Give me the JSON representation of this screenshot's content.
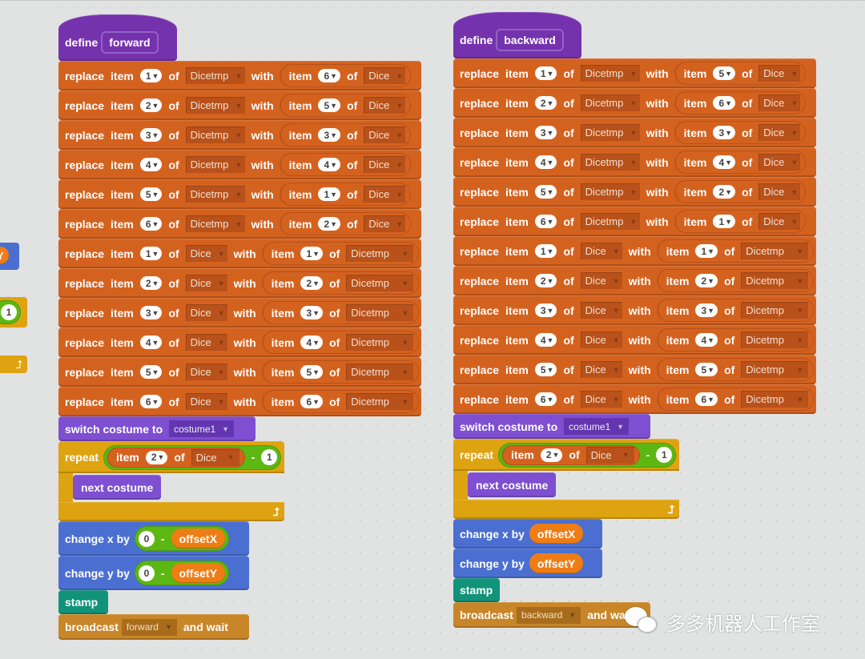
{
  "scripts": [
    {
      "hat": {
        "keyword": "define",
        "name": "forward"
      },
      "replace_blocks": [
        {
          "index": "1",
          "list": "Dicetmp",
          "src_index": "6",
          "src_list": "Dice"
        },
        {
          "index": "2",
          "list": "Dicetmp",
          "src_index": "5",
          "src_list": "Dice"
        },
        {
          "index": "3",
          "list": "Dicetmp",
          "src_index": "3",
          "src_list": "Dice"
        },
        {
          "index": "4",
          "list": "Dicetmp",
          "src_index": "4",
          "src_list": "Dice"
        },
        {
          "index": "5",
          "list": "Dicetmp",
          "src_index": "1",
          "src_list": "Dice"
        },
        {
          "index": "6",
          "list": "Dicetmp",
          "src_index": "2",
          "src_list": "Dice"
        },
        {
          "index": "1",
          "list": "Dice",
          "src_index": "1",
          "src_list": "Dicetmp"
        },
        {
          "index": "2",
          "list": "Dice",
          "src_index": "2",
          "src_list": "Dicetmp"
        },
        {
          "index": "3",
          "list": "Dice",
          "src_index": "3",
          "src_list": "Dicetmp"
        },
        {
          "index": "4",
          "list": "Dice",
          "src_index": "4",
          "src_list": "Dicetmp"
        },
        {
          "index": "5",
          "list": "Dice",
          "src_index": "5",
          "src_list": "Dicetmp"
        },
        {
          "index": "6",
          "list": "Dice",
          "src_index": "6",
          "src_list": "Dicetmp"
        }
      ],
      "switch_costume": {
        "label": "switch costume to",
        "value": "costume1"
      },
      "repeat": {
        "label": "repeat",
        "item_index": "2",
        "list": "Dice",
        "operator": "-",
        "operand": "1",
        "inner": "next costume"
      },
      "change_x": {
        "label": "change x by",
        "left": "0",
        "operator": "-",
        "var": "offsetX"
      },
      "change_y": {
        "label": "change y by",
        "left": "0",
        "operator": "-",
        "var": "offsetY"
      },
      "stamp": "stamp",
      "broadcast": {
        "label": "broadcast",
        "message": "forward",
        "suffix": "and wait"
      }
    },
    {
      "hat": {
        "keyword": "define",
        "name": "backward"
      },
      "replace_blocks": [
        {
          "index": "1",
          "list": "Dicetmp",
          "src_index": "5",
          "src_list": "Dice"
        },
        {
          "index": "2",
          "list": "Dicetmp",
          "src_index": "6",
          "src_list": "Dice"
        },
        {
          "index": "3",
          "list": "Dicetmp",
          "src_index": "3",
          "src_list": "Dice"
        },
        {
          "index": "4",
          "list": "Dicetmp",
          "src_index": "4",
          "src_list": "Dice"
        },
        {
          "index": "5",
          "list": "Dicetmp",
          "src_index": "2",
          "src_list": "Dice"
        },
        {
          "index": "6",
          "list": "Dicetmp",
          "src_index": "1",
          "src_list": "Dice"
        },
        {
          "index": "1",
          "list": "Dice",
          "src_index": "1",
          "src_list": "Dicetmp"
        },
        {
          "index": "2",
          "list": "Dice",
          "src_index": "2",
          "src_list": "Dicetmp"
        },
        {
          "index": "3",
          "list": "Dice",
          "src_index": "3",
          "src_list": "Dicetmp"
        },
        {
          "index": "4",
          "list": "Dice",
          "src_index": "4",
          "src_list": "Dicetmp"
        },
        {
          "index": "5",
          "list": "Dice",
          "src_index": "5",
          "src_list": "Dicetmp"
        },
        {
          "index": "6",
          "list": "Dice",
          "src_index": "6",
          "src_list": "Dicetmp"
        }
      ],
      "switch_costume": {
        "label": "switch costume to",
        "value": "costume1"
      },
      "repeat": {
        "label": "repeat",
        "item_index": "2",
        "list": "Dice",
        "operator": "-",
        "operand": "1",
        "inner": "next costume"
      },
      "change_x": {
        "label": "change x by",
        "var": "offsetX"
      },
      "change_y": {
        "label": "change y by",
        "var": "offsetY"
      },
      "stamp": "stamp",
      "broadcast": {
        "label": "broadcast",
        "message": "backward",
        "suffix": "and wait"
      }
    }
  ],
  "block_words": {
    "replace": "replace",
    "item": "item",
    "of": "of",
    "with": "with"
  },
  "partial_left": {
    "number": "1",
    "var_fragment": "Y"
  },
  "watermark": {
    "icon": "wechat-icon",
    "text": "多多机器人工作室"
  },
  "colors": {
    "list": "#d4621f",
    "looks": "#7e4fd1",
    "motion": "#4b6fd1",
    "control": "#dea311",
    "pen": "#11937a",
    "events": "#c98628",
    "operators": "#5cb712",
    "variables": "#ee7d16",
    "define": "#7532ad",
    "canvas": "#e1e2e2"
  }
}
